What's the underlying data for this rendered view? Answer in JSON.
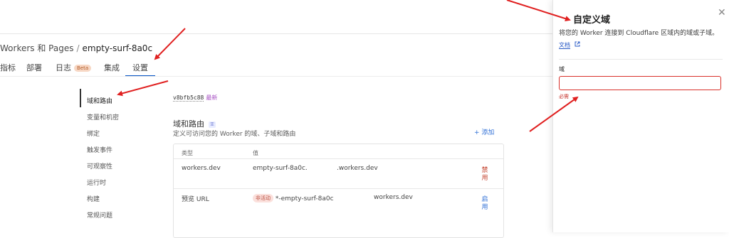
{
  "breadcrumb": {
    "parent": "Workers 和 Pages",
    "separator": "/",
    "current": "empty-surf-8a0c"
  },
  "tabs": [
    {
      "label": "指标"
    },
    {
      "label": "部署"
    },
    {
      "label": "日志",
      "badge": "Beta"
    },
    {
      "label": "集成"
    },
    {
      "label": "设置",
      "active": true
    }
  ],
  "sidenav": [
    {
      "label": "域和路由",
      "active": true
    },
    {
      "label": "变量和机密"
    },
    {
      "label": "绑定"
    },
    {
      "label": "触发事件"
    },
    {
      "label": "可观察性"
    },
    {
      "label": "运行时"
    },
    {
      "label": "构建"
    },
    {
      "label": "常规问题"
    }
  ],
  "version": {
    "hash": "v8bfb5c88",
    "latest": "最新"
  },
  "section": {
    "title": "域和路由",
    "badge": "亚",
    "description": "定义可访问您的 Worker 的域、子域和路由",
    "add_label": "+ 添加"
  },
  "table": {
    "headers": {
      "type": "类型",
      "value": "值"
    },
    "rows": [
      {
        "type": "workers.dev",
        "value_left": "empty-surf-8a0c.",
        "value_right": ".workers.dev",
        "action": "禁用",
        "action_color": "#c3412c"
      },
      {
        "type": "预览 URL",
        "status": "非活动",
        "value_left": "*-empty-surf-8a0c",
        "value_right": "workers.dev",
        "action": "启用",
        "action_color": "#2f6fd6"
      }
    ]
  },
  "panel": {
    "title": "自定义域",
    "description": "将您的 Worker 连接到 Cloudflare 区域内的域或子域。",
    "doc_link": "文档",
    "field_label": "域",
    "field_value": "",
    "field_error": "必需",
    "close_icon": "close-icon",
    "external_icon": "external-link-icon"
  },
  "colors": {
    "accent": "#0051c3",
    "annotation": "#e02020",
    "error": "#d9302a"
  }
}
